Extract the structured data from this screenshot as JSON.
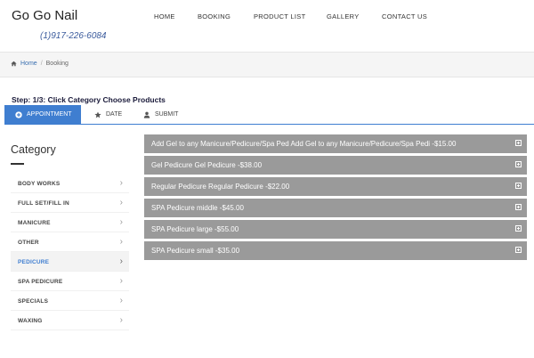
{
  "header": {
    "brand": "Go Go Nail",
    "phone": "(1)917-226-6084",
    "nav": [
      "HOME",
      "BOOKING",
      "PRODUCT LIST",
      "GALLERY",
      "CONTACT US"
    ]
  },
  "breadcrumb": {
    "home": "Home",
    "separator": "/",
    "current": "Booking"
  },
  "step_text": "Step: 1/3: Click Category Choose Products",
  "tabs": {
    "appointment": "APPOINTMENT",
    "date": "DATE",
    "submit": "SUBMIT"
  },
  "category": {
    "title": "Category",
    "items": [
      "BODY WORKS",
      "FULL SET/FILL IN",
      "MANICURE",
      "OTHER",
      "PEDICURE",
      "SPA PEDICURE",
      "SPECIALS",
      "WAXING"
    ],
    "active": "PEDICURE"
  },
  "products": [
    "Add Gel to any Manicure/Pedicure/Spa Ped Add Gel to any Manicure/Pedicure/Spa Pedi -$15.00",
    "Gel Pedicure Gel Pedicure -$38.00",
    "Regular Pedicure Regular Pedicure -$22.00",
    "SPA Pedicure middle -$45.00",
    "SPA Pedicure large -$55.00",
    "SPA Pedicure small -$35.00"
  ],
  "colors": {
    "accent": "#3f7ed0",
    "product_bg": "#9a9a9a",
    "phone": "#3a5a9c"
  },
  "icons": {
    "home": "home-icon",
    "appointment": "plus-circle-icon",
    "date": "star-icon",
    "submit": "user-icon",
    "expand": "plus-square-icon",
    "chevron": "chevron-right-icon"
  }
}
